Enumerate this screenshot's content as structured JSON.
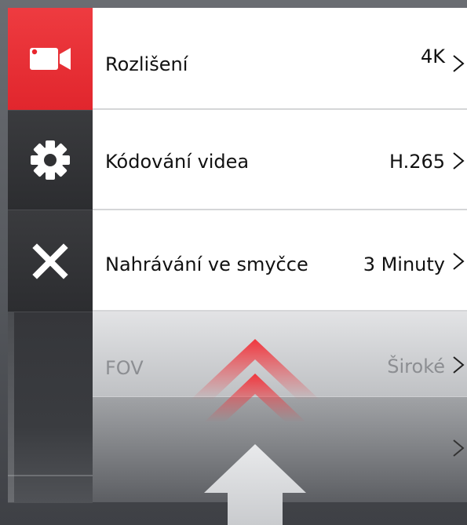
{
  "sidebar": {
    "items": [
      {
        "icon": "video-camera-icon",
        "active": true
      },
      {
        "icon": "gear-icon",
        "active": false
      },
      {
        "icon": "close-icon",
        "active": false
      }
    ]
  },
  "menu": {
    "rows": [
      {
        "label": "Rozlišení",
        "value": "4K"
      },
      {
        "label": "Kódování videa",
        "value": "H.265"
      },
      {
        "label": "Nahrávání ve smyčce",
        "value": "3 Minuty"
      },
      {
        "label": "FOV",
        "value": "Široké"
      },
      {
        "label": "",
        "value": ""
      }
    ]
  },
  "overlay": {
    "icon": "swipe-up-arrow-icon"
  },
  "colors": {
    "accent": "#e8262d",
    "sidebar_dark": "#303134",
    "row_background": "#ffffff",
    "text": "#111111",
    "disabled_text": "#8c8e92"
  }
}
